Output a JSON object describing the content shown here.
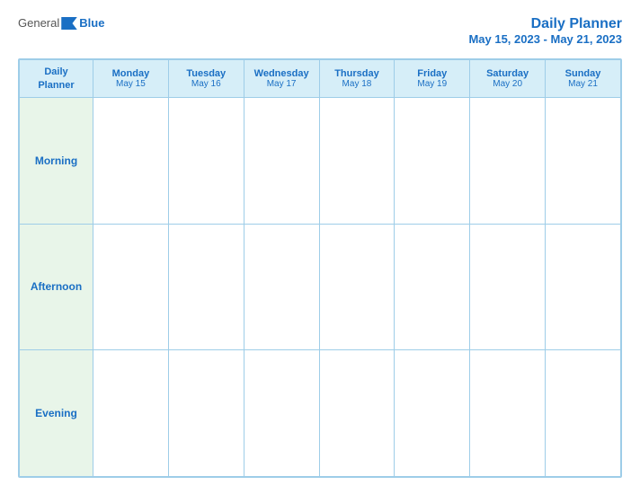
{
  "logo": {
    "general": "General",
    "blue": "Blue"
  },
  "title": {
    "main": "Daily Planner",
    "date_range": "May 15, 2023 - May 21, 2023"
  },
  "header_row": {
    "label_line1": "Daily",
    "label_line2": "Planner",
    "days": [
      {
        "name": "Monday",
        "date": "May 15"
      },
      {
        "name": "Tuesday",
        "date": "May 16"
      },
      {
        "name": "Wednesday",
        "date": "May 17"
      },
      {
        "name": "Thursday",
        "date": "May 18"
      },
      {
        "name": "Friday",
        "date": "May 19"
      },
      {
        "name": "Saturday",
        "date": "May 20"
      },
      {
        "name": "Sunday",
        "date": "May 21"
      }
    ]
  },
  "rows": [
    {
      "label": "Morning"
    },
    {
      "label": "Afternoon"
    },
    {
      "label": "Evening"
    }
  ]
}
